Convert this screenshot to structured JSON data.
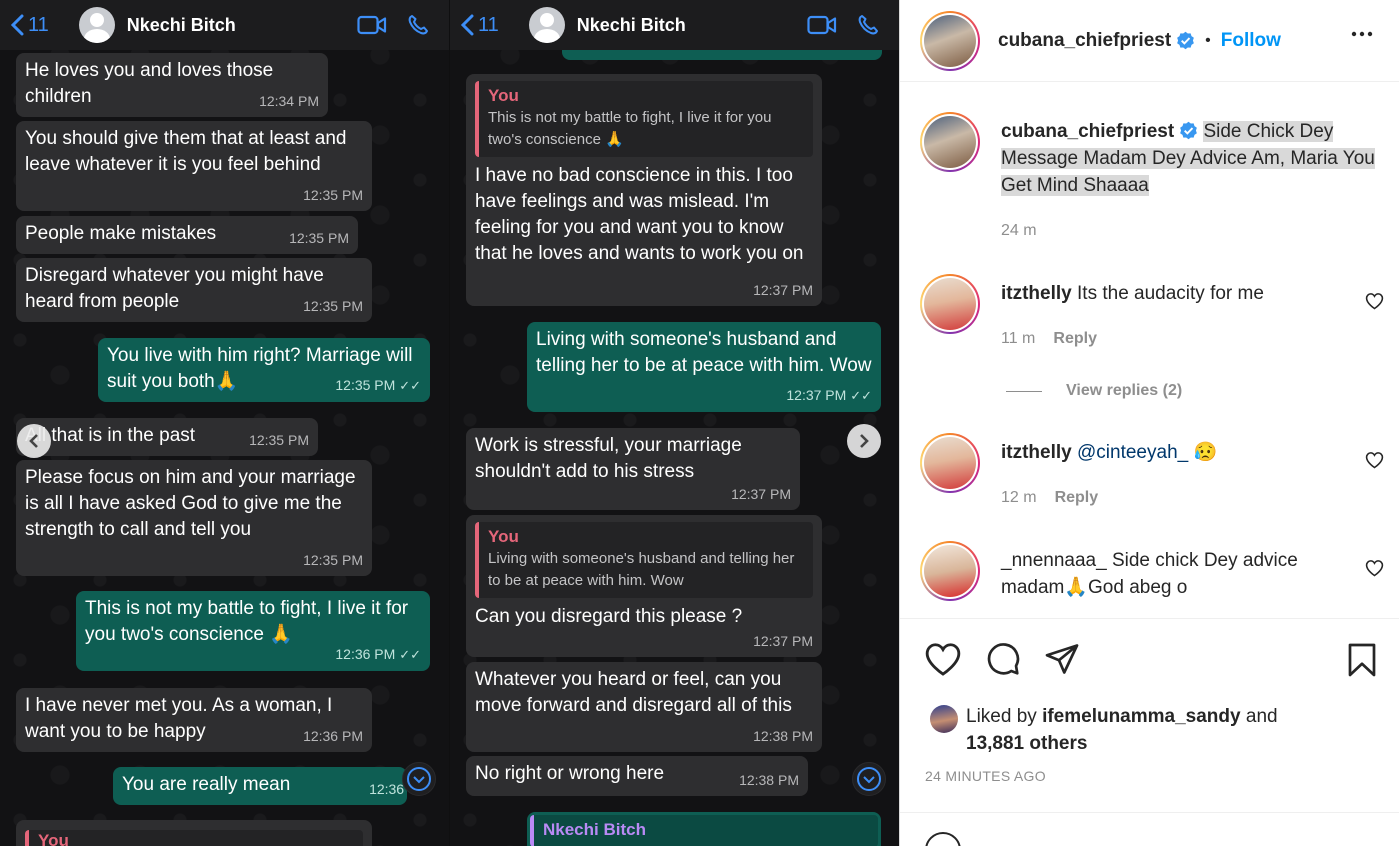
{
  "whatsapp": {
    "back_count": "11",
    "contact_name": "Nkechi Bitch",
    "panel_a": {
      "messages": [
        {
          "dir": "in",
          "text": "He loves you and loves those children",
          "time": "12:34 PM"
        },
        {
          "dir": "in",
          "text": "You should give them that at least and leave whatever it is you feel behind",
          "time": "12:35 PM"
        },
        {
          "dir": "in",
          "text": "People make mistakes",
          "time": "12:35 PM"
        },
        {
          "dir": "in",
          "text": "Disregard whatever you might have heard from people",
          "time": "12:35 PM"
        },
        {
          "dir": "out",
          "text": "You live with him right? Marriage will suit you both🙏",
          "time": "12:35 PM"
        },
        {
          "dir": "in",
          "text": "All that is in the past",
          "time": "12:35 PM"
        },
        {
          "dir": "in",
          "text": "Please focus on him and your marriage is all I have asked God to give me the strength to call and tell you",
          "time": "12:35 PM"
        },
        {
          "dir": "out",
          "text": "This is not my battle to fight, I live it for you two's conscience 🙏",
          "time": "12:36 PM"
        },
        {
          "dir": "in",
          "text": "I have never met you. As a woman, I want you to be happy",
          "time": "12:36 PM"
        },
        {
          "dir": "out",
          "text": "You are really mean",
          "time": "12:36 PM"
        }
      ],
      "partial_quote_author": "You"
    },
    "panel_b": {
      "messages": [
        {
          "dir": "in",
          "quote_author": "You",
          "quote_text": "This is not my battle to fight, I live it for you two's conscience 🙏",
          "text": "I have no bad conscience in this. I too have feelings and was mislead. I'm feeling for you and want you to know that he loves and wants to work you on",
          "time": "12:37 PM"
        },
        {
          "dir": "out",
          "text": "Living with someone's husband and telling her to be at peace with him. Wow",
          "time": "12:37 PM"
        },
        {
          "dir": "in",
          "text": "Work is stressful, your marriage shouldn't add to his stress",
          "time": "12:37 PM"
        },
        {
          "dir": "in",
          "quote_author": "You",
          "quote_text": "Living with someone's husband and telling her to be at peace with him. Wow",
          "text": "Can you disregard this please ?",
          "time": "12:37 PM"
        },
        {
          "dir": "in",
          "text": "Whatever you heard or feel, can you move forward and disregard all of this",
          "time": "12:38 PM"
        },
        {
          "dir": "in",
          "text": "No right or wrong here",
          "time": "12:38 PM"
        }
      ],
      "partial_quote_author": "Nkechi Bitch"
    },
    "read_tick": "✓✓"
  },
  "instagram": {
    "header": {
      "username": "cubana_chiefpriest",
      "separator": "•",
      "follow_label": "Follow"
    },
    "caption": {
      "username": "cubana_chiefpriest",
      "text": "Side Chick Dey Message Madam Dey Advice Am, Maria You Get Mind Shaaaa",
      "time": "24 m"
    },
    "comments": [
      {
        "username": "itzthelly",
        "text": "Its the audacity for me",
        "time": "11 m",
        "reply_label": "Reply",
        "view_replies": "View replies (2)"
      },
      {
        "username": "itzthelly",
        "mention": "@cinteeyah_",
        "emoji": "😥",
        "time": "12 m",
        "reply_label": "Reply"
      },
      {
        "username": "_nnennaaa_",
        "text": "Side chick Dey advice madam🙏God abeg o"
      }
    ],
    "likes": {
      "prefix": "Liked by",
      "user": "ifemelunamma_sandy",
      "middle": "and",
      "count": "13,881 others"
    },
    "posted": "24 MINUTES AGO",
    "colors": {
      "accent": "#0095f6",
      "verified": "#3897f0",
      "text": "#262626",
      "muted": "#8e8e8e"
    },
    "icons": [
      "more-icon",
      "verified-icon",
      "heart-icon",
      "comment-icon",
      "share-icon",
      "bookmark-icon"
    ]
  }
}
